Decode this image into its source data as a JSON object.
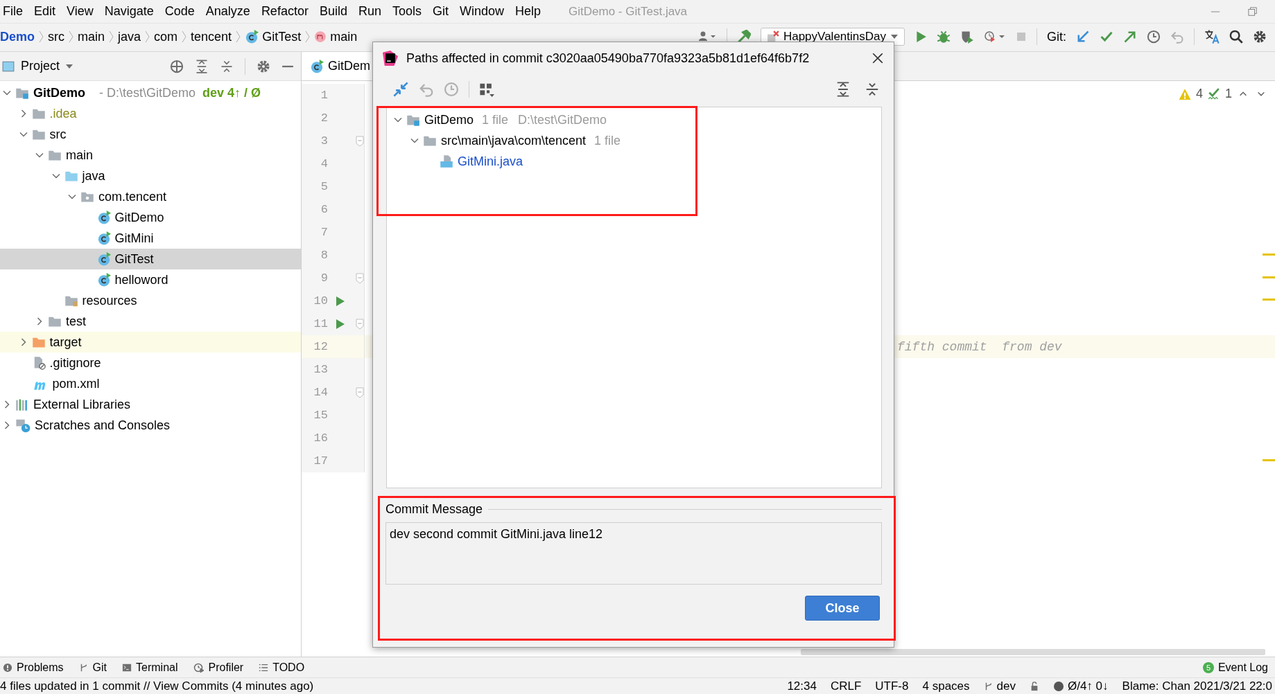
{
  "menu_bar": {
    "items": [
      "File",
      "Edit",
      "View",
      "Navigate",
      "Code",
      "Analyze",
      "Refactor",
      "Build",
      "Run",
      "Tools",
      "Git",
      "Window",
      "Help"
    ],
    "title": "GitDemo - GitTest.java"
  },
  "navigation_bar": {
    "breadcrumbs": [
      {
        "label": "Demo",
        "kind": "module"
      },
      {
        "label": "src",
        "kind": "plain"
      },
      {
        "label": "main",
        "kind": "plain"
      },
      {
        "label": "java",
        "kind": "plain"
      },
      {
        "label": "com",
        "kind": "plain"
      },
      {
        "label": "tencent",
        "kind": "plain"
      },
      {
        "label": "GitTest",
        "kind": "class"
      },
      {
        "label": "main",
        "kind": "method"
      }
    ],
    "run_configuration": "HappyValentinsDay",
    "git_label": "Git:"
  },
  "project_panel": {
    "title": "Project",
    "tree": [
      {
        "label": "GitDemo",
        "kind": "module",
        "path": "- D:\\test\\GitDemo",
        "branch": "dev 4↑ / Ø",
        "expanded": true,
        "selected": false,
        "highlighted": false,
        "ignored": false,
        "children": [
          {
            "label": ".idea",
            "kind": "folder",
            "expanded": false,
            "selected": false,
            "highlighted": false,
            "ignored": true
          },
          {
            "label": "src",
            "kind": "folder",
            "expanded": true,
            "selected": false,
            "highlighted": false,
            "ignored": false,
            "children": [
              {
                "label": "main",
                "kind": "folder",
                "expanded": true,
                "selected": false,
                "highlighted": false,
                "ignored": false,
                "children": [
                  {
                    "label": "java",
                    "kind": "source",
                    "expanded": true,
                    "selected": false,
                    "highlighted": false,
                    "ignored": false,
                    "children": [
                      {
                        "label": "com.tencent",
                        "kind": "package",
                        "expanded": true,
                        "selected": false,
                        "highlighted": false,
                        "ignored": false,
                        "children": [
                          {
                            "label": "GitDemo",
                            "kind": "class",
                            "selected": false,
                            "highlighted": false,
                            "ignored": false
                          },
                          {
                            "label": "GitMini",
                            "kind": "class",
                            "selected": false,
                            "highlighted": false,
                            "ignored": false
                          },
                          {
                            "label": "GitTest",
                            "kind": "class",
                            "selected": true,
                            "highlighted": false,
                            "ignored": false
                          },
                          {
                            "label": "helloword",
                            "kind": "class",
                            "selected": false,
                            "highlighted": false,
                            "ignored": false
                          }
                        ]
                      }
                    ]
                  },
                  {
                    "label": "resources",
                    "kind": "resources",
                    "selected": false,
                    "highlighted": false,
                    "ignored": false
                  }
                ]
              },
              {
                "label": "test",
                "kind": "folder",
                "expanded": false,
                "selected": false,
                "highlighted": false,
                "ignored": false
              }
            ]
          },
          {
            "label": "target",
            "kind": "excluded",
            "expanded": false,
            "selected": false,
            "highlighted": true,
            "ignored": false
          },
          {
            "label": ".gitignore",
            "kind": "gitignore",
            "selected": false,
            "highlighted": false,
            "ignored": false
          },
          {
            "label": "pom.xml",
            "kind": "maven",
            "selected": false,
            "highlighted": false,
            "ignored": false
          }
        ]
      },
      {
        "label": "External Libraries",
        "kind": "libraries",
        "expanded": false,
        "selected": false,
        "highlighted": false,
        "ignored": false
      },
      {
        "label": "Scratches and Consoles",
        "kind": "scratches",
        "expanded": false,
        "selected": false,
        "highlighted": false,
        "ignored": false
      }
    ]
  },
  "editor": {
    "tabs": [
      {
        "label": "GitDem",
        "selected": true
      }
    ],
    "warnings": "4",
    "checks": "1",
    "lines": [
      {
        "number": "1",
        "run": false,
        "fold": false,
        "current": false
      },
      {
        "number": "2",
        "run": false,
        "fold": false,
        "current": false
      },
      {
        "number": "3",
        "run": false,
        "fold": true,
        "current": false
      },
      {
        "number": "4",
        "run": false,
        "fold": false,
        "current": false
      },
      {
        "number": "5",
        "run": false,
        "fold": false,
        "current": false
      },
      {
        "number": "6",
        "run": false,
        "fold": false,
        "current": false
      },
      {
        "number": "7",
        "run": false,
        "fold": false,
        "current": false
      },
      {
        "number": "8",
        "run": false,
        "fold": false,
        "current": false
      },
      {
        "number": "9",
        "run": false,
        "fold": true,
        "current": false
      },
      {
        "number": "10",
        "run": true,
        "fold": false,
        "current": false
      },
      {
        "number": "11",
        "run": true,
        "fold": true,
        "current": false
      },
      {
        "number": "12",
        "run": false,
        "fold": false,
        "current": true,
        "text": "fifth commit  from dev"
      },
      {
        "number": "13",
        "run": false,
        "fold": false,
        "current": false
      },
      {
        "number": "14",
        "run": false,
        "fold": true,
        "current": false
      },
      {
        "number": "15",
        "run": false,
        "fold": false,
        "current": false
      },
      {
        "number": "16",
        "run": false,
        "fold": false,
        "current": false
      },
      {
        "number": "17",
        "run": false,
        "fold": false,
        "current": false
      }
    ]
  },
  "dialog": {
    "title": "Paths affected in commit c3020aa05490ba770fa9323a5b81d1ef64f6b7f2",
    "tree": [
      {
        "label": "GitDemo",
        "kind": "module",
        "count": "1 file",
        "path": "D:\\test\\GitDemo",
        "expanded": true,
        "children": [
          {
            "label": "src\\main\\java\\com\\tencent",
            "kind": "folder",
            "count": "1 file",
            "expanded": true,
            "children": [
              {
                "label": "GitMini.java",
                "kind": "java-file",
                "modified": true
              }
            ]
          }
        ]
      }
    ],
    "commit_message_label": "Commit Message",
    "commit_message": "dev second commit GitMini.java line12",
    "close_button": "Close"
  },
  "tool_window_bar": {
    "items": [
      {
        "label": "Problems",
        "kind": "problems"
      },
      {
        "label": "Git",
        "kind": "git"
      },
      {
        "label": "Terminal",
        "kind": "terminal"
      },
      {
        "label": "Profiler",
        "kind": "profiler"
      },
      {
        "label": "TODO",
        "kind": "todo"
      }
    ],
    "event_log": {
      "label": "Event Log",
      "count": "5"
    }
  },
  "status_bar": {
    "message": "4 files updated in 1 commit // View Commits (4 minutes ago)",
    "items": [
      "12:34",
      "CRLF",
      "UTF-8",
      "4 spaces"
    ],
    "branch": "dev",
    "vcs": "Ø/4↑ 0↓",
    "blame": "Blame: Chan 2021/3/21 22:0"
  }
}
